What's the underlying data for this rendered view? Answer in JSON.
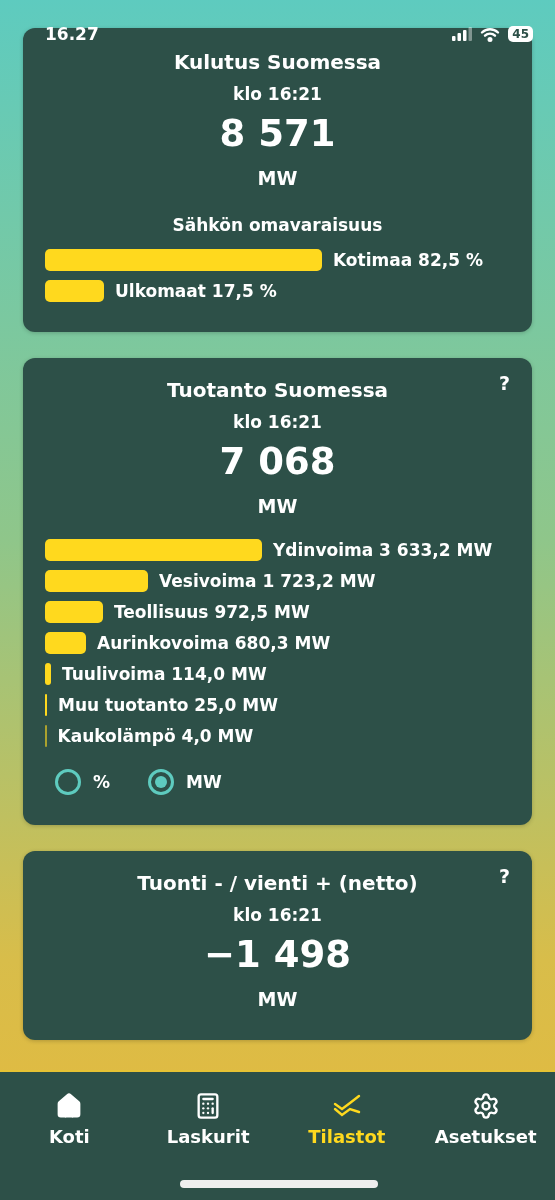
{
  "status_bar": {
    "time": "16.27",
    "battery": "45"
  },
  "consumption": {
    "title": "Kulutus Suomessa",
    "time": "klo 16:21",
    "value": "8 571",
    "unit": "MW",
    "subtitle": "Sähkön omavaraisuus",
    "bars": [
      {
        "label": "Kotimaa 82,5 %"
      },
      {
        "label": "Ulkomaat 17,5 %"
      }
    ]
  },
  "production": {
    "title": "Tuotanto Suomessa",
    "help": "?",
    "time": "klo 16:21",
    "value": "7 068",
    "unit": "MW",
    "bars": [
      {
        "label": "Ydinvoima 3 633,2 MW"
      },
      {
        "label": "Vesivoima 1 723,2 MW"
      },
      {
        "label": "Teollisuus 972,5 MW"
      },
      {
        "label": "Aurinkovoima 680,3 MW"
      },
      {
        "label": "Tuulivoima 114,0 MW"
      },
      {
        "label": "Muu tuotanto 25,0 MW"
      },
      {
        "label": "Kaukolämpö 4,0 MW"
      }
    ],
    "units": [
      {
        "label": "%",
        "selected": false
      },
      {
        "label": "MW",
        "selected": true
      }
    ]
  },
  "net": {
    "title": "Tuonti - / vienti + (netto)",
    "help": "?",
    "time": "klo 16:21",
    "value": "−1 498",
    "unit": "MW"
  },
  "tabs": [
    {
      "label": "Koti",
      "selected": false
    },
    {
      "label": "Laskurit",
      "selected": false
    },
    {
      "label": "Tilastot",
      "selected": true
    },
    {
      "label": "Asetukset",
      "selected": false
    }
  ]
}
